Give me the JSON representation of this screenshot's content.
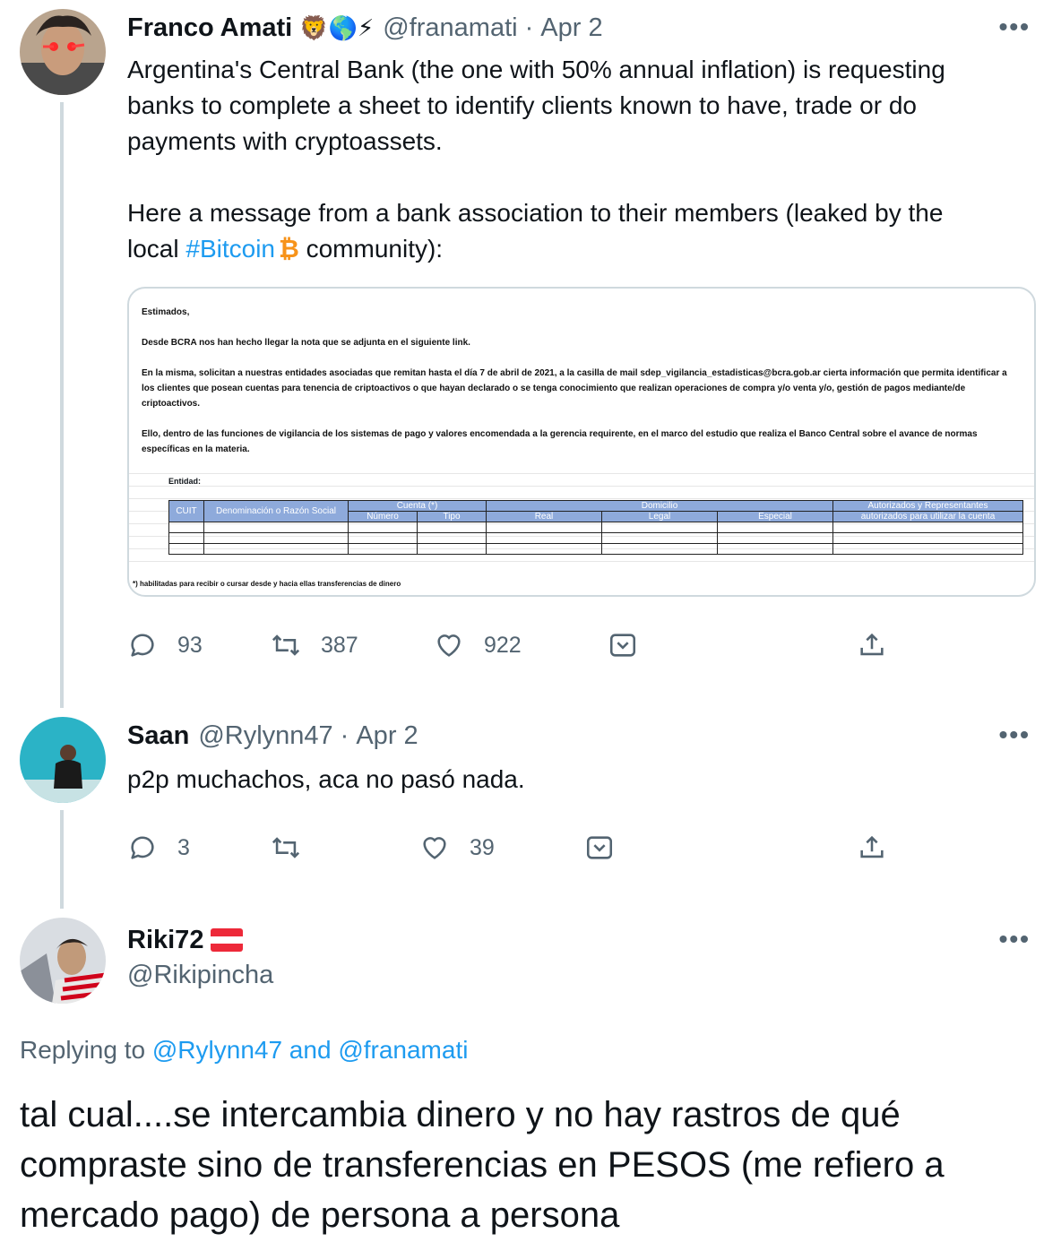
{
  "tweet1": {
    "name": "Franco Amati",
    "emoji": "🦁🌎⚡",
    "handle": "@franamati",
    "date": "Apr 2",
    "text_line1": "Argentina's Central Bank (the one with 50% annual inflation) is requesting",
    "text_line2": "banks to complete a sheet to identify clients known to have, trade or do",
    "text_line3": "payments with cryptoassets.",
    "text_line4": "Here a message from a bank association to their members (leaked by the",
    "text_line5_pre": "local ",
    "hashtag": "#Bitcoin",
    "bitcoin_glyph": "₿",
    "text_line5_post": " community):",
    "replies": "93",
    "retweets": "387",
    "likes": "922"
  },
  "document": {
    "greeting": "Estimados,",
    "para1": "Desde BCRA nos han hecho llegar la nota que se adjunta en el siguiente link.",
    "para2": "En la misma, solicitan a nuestras entidades asociadas que remitan hasta el día 7 de abril de 2021, a la casilla de mail sdep_vigilancia_estadisticas@bcra.gob.ar cierta información que permita identificar a los clientes que posean cuentas para tenencia de criptoactivos o que hayan declarado o se tenga conocimiento que realizan operaciones de compra y/o venta y/o, gestión de pagos mediante/de criptoactivos.",
    "para3": "Ello, dentro de las funciones de vigilancia de los sistemas de pago y valores encomendada a la gerencia requirente, en el marco del estudio que realiza el Banco Central sobre el avance de normas específicas en la materia.",
    "entidad": "Entidad:",
    "cols": {
      "cuit": "CUIT",
      "denominacion": "Denominación o Razón Social",
      "cuenta": "Cuenta (*)",
      "numero": "Número",
      "tipo": "Tipo",
      "domicilio": "Domicilio",
      "real": "Real",
      "legal": "Legal",
      "especial": "Especial",
      "autorizados_1": "Autorizados y Representantes",
      "autorizados_2": "autorizados para utilizar la cuenta"
    },
    "footnote": "*) habilitadas para recibir o cursar desde y hacia ellas transferencias de dinero"
  },
  "tweet2": {
    "name": "Saan",
    "handle": "@Rylynn47",
    "date": "Apr 2",
    "text": "p2p muchachos, aca no pasó nada.",
    "replies": "3",
    "likes": "39"
  },
  "tweet3": {
    "name": "Riki72",
    "handle": "@Rikipincha",
    "replying_prefix": "Replying to ",
    "reply_to_1": "@Rylynn47",
    "reply_and": " and ",
    "reply_to_2": "@franamati",
    "text": "tal cual....se intercambia dinero y no hay rastros de qué compraste sino de transferencias en PESOS (me refiero a mercado pago) de persona a persona"
  },
  "more_label": "•••",
  "colors": {
    "link": "#1d9bf0",
    "secondary": "#536471",
    "thread": "#cfd9de",
    "table_header": "#8eaadb"
  }
}
